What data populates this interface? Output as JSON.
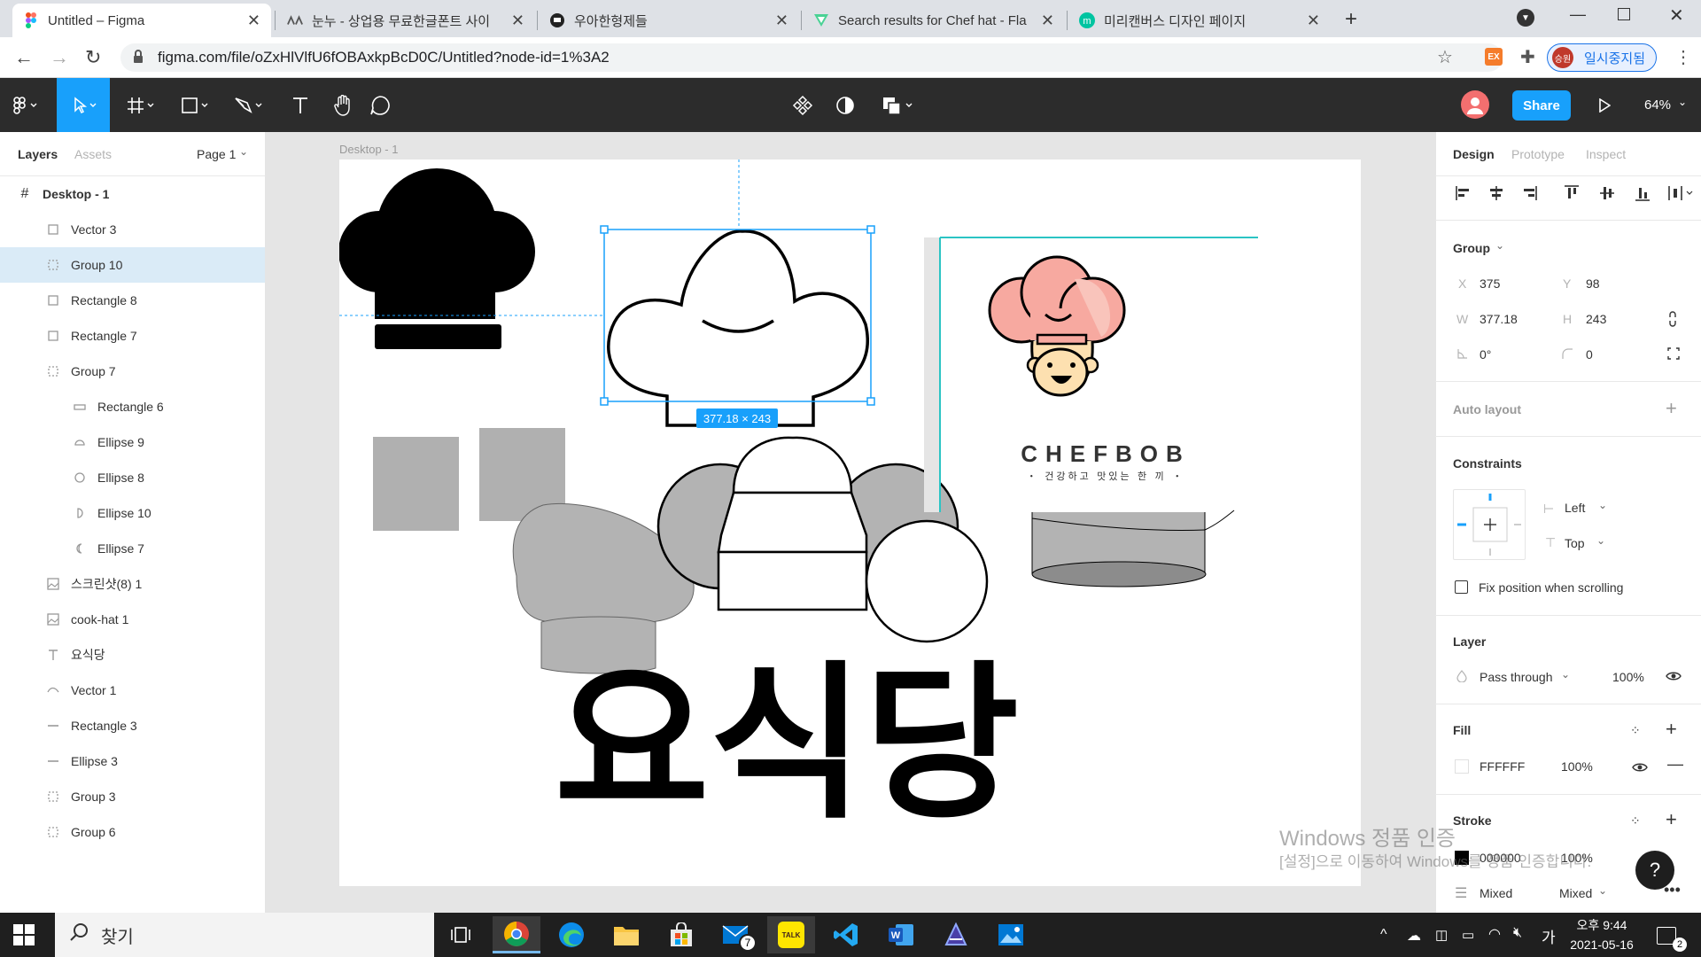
{
  "browser": {
    "tabs": [
      {
        "label": "Untitled – Figma",
        "active": true
      },
      {
        "label": "눈누 - 상업용 무료한글폰트 사이",
        "active": false
      },
      {
        "label": "우아한형제들",
        "active": false
      },
      {
        "label": "Search results for Chef hat - Fla",
        "active": false
      },
      {
        "label": "미리캔버스 디자인 페이지",
        "active": false
      }
    ],
    "url": "figma.com/file/oZxHlVlfU6fOBAxkpBcD0C/Untitled?node-id=1%3A2",
    "profile_label": "일시중지됨",
    "profile_avatar": "승원",
    "ext_label": "EX"
  },
  "toolbar": {
    "share_label": "Share",
    "zoom_label": "64%"
  },
  "left_panel": {
    "tabs": {
      "layers": "Layers",
      "assets": "Assets",
      "page": "Page 1"
    },
    "frame_name": "Desktop - 1",
    "layers": [
      {
        "name": "Vector 3",
        "icon": "rect-icon",
        "indent": 1
      },
      {
        "name": "Group 10",
        "icon": "group-icon",
        "indent": 1,
        "selected": true
      },
      {
        "name": "Rectangle 8",
        "icon": "rect-icon",
        "indent": 1
      },
      {
        "name": "Rectangle 7",
        "icon": "rect-icon",
        "indent": 1
      },
      {
        "name": "Group 7",
        "icon": "group-icon",
        "indent": 1
      },
      {
        "name": "Rectangle 6",
        "icon": "rect-flat-icon",
        "indent": 2
      },
      {
        "name": "Ellipse 9",
        "icon": "arc-icon",
        "indent": 2
      },
      {
        "name": "Ellipse 8",
        "icon": "ellipse-icon",
        "indent": 2
      },
      {
        "name": "Ellipse 10",
        "icon": "half-ellipse-icon",
        "indent": 2
      },
      {
        "name": "Ellipse 7",
        "icon": "crescent-icon",
        "indent": 2
      },
      {
        "name": "스크린샷(8) 1",
        "icon": "image-icon",
        "indent": 1
      },
      {
        "name": "cook-hat 1",
        "icon": "image-icon",
        "indent": 1
      },
      {
        "name": "요식당",
        "icon": "text-icon",
        "indent": 1
      },
      {
        "name": "Vector 1",
        "icon": "vector-icon",
        "indent": 1
      },
      {
        "name": "Rectangle 3",
        "icon": "line-icon",
        "indent": 1
      },
      {
        "name": "Ellipse 3",
        "icon": "line-icon",
        "indent": 1
      },
      {
        "name": "Group 3",
        "icon": "group-icon",
        "indent": 1
      },
      {
        "name": "Group 6",
        "icon": "group-icon",
        "indent": 1
      }
    ]
  },
  "canvas": {
    "frame_label": "Desktop - 1",
    "size_badge": "377.18 × 243",
    "logo_title": "CHEFBOB",
    "logo_sub": "・ 건강하고 맛있는 한 끼 ・",
    "korean_title": "요식당"
  },
  "right_panel": {
    "tabs": {
      "design": "Design",
      "prototype": "Prototype",
      "inspect": "Inspect"
    },
    "group_label": "Group",
    "x_label": "X",
    "x_value": "375",
    "y_label": "Y",
    "y_value": "98",
    "w_label": "W",
    "w_value": "377.18",
    "h_label": "H",
    "h_value": "243",
    "rotation_value": "0°",
    "radius_value": "0",
    "auto_layout": "Auto layout",
    "constraints_title": "Constraints",
    "constraint_h": "Left",
    "constraint_v": "Top",
    "fix_position": "Fix position when scrolling",
    "layer_title": "Layer",
    "blend_mode": "Pass through",
    "layer_opacity": "100%",
    "fill_title": "Fill",
    "fill_hex": "FFFFFF",
    "fill_opacity": "100%",
    "stroke_title": "Stroke",
    "stroke_hex": "000000",
    "stroke_opacity": "100%",
    "stroke_mixed1": "Mixed",
    "stroke_mixed2": "Mixed"
  },
  "watermark": {
    "line1": "Windows 정품 인증",
    "line2": "[설정]으로 이동하여 Windows를 정품 인증합니다."
  },
  "taskbar": {
    "search_label": "찾기",
    "time": "오후 9:44",
    "date": "2021-05-16",
    "ime": "가",
    "mail_badge": "7",
    "notif_count": "2",
    "kakao_label": "TALK"
  },
  "colors": {
    "figma_blue": "#18a0fb",
    "share_blue": "#18a0fb",
    "dark_toolbar": "#2c2c2c",
    "selected_row": "#daebf7"
  }
}
